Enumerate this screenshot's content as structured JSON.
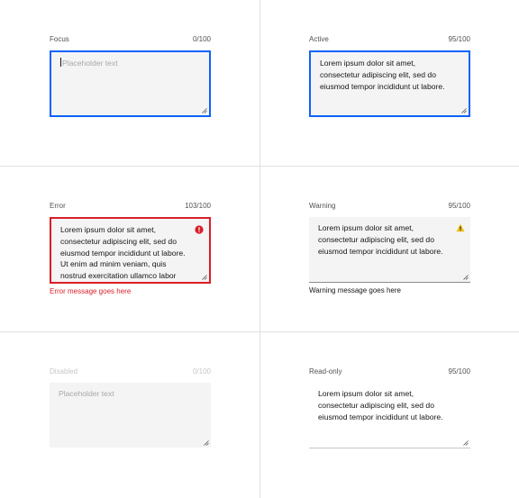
{
  "colors": {
    "focus": "#0f62fe",
    "error": "#da1e28",
    "warning": "#f1c21b",
    "field_bg": "#f4f4f4",
    "divider": "#e0e0e0"
  },
  "states": {
    "focus": {
      "label": "Focus",
      "count": "0/100",
      "placeholder": "Placeholder text"
    },
    "active": {
      "label": "Active",
      "count": "95/100",
      "value": "Lorem ipsum dolor sit amet,\nconsectetur adipiscing elit, sed do\neiusmod tempor incididunt ut labore."
    },
    "error": {
      "label": "Error",
      "count": "103/100",
      "value": "Lorem ipsum dolor sit amet,\nconsectetur adipiscing elit, sed do\neiusmod tempor incididunt ut labore.\nUt enim ad minim veniam, quis\nnostrud exercitation ullamco labor",
      "message": "Error message goes here",
      "icon": "error-filled-icon"
    },
    "warning": {
      "label": "Warning",
      "count": "95/100",
      "value": "Lorem ipsum dolor sit amet,\nconsectetur adipiscing elit, sed do\neiusmod tempor incididunt ut labore.",
      "message": "Warning message goes here",
      "icon": "warning-filled-icon"
    },
    "disabled": {
      "label": "Disabled",
      "count": "0/100",
      "placeholder": "Placeholder text"
    },
    "readonly": {
      "label": "Read-only",
      "count": "95/100",
      "value": "Lorem ipsum dolor sit amet,\nconsectetur adipiscing elit, sed do\neiusmod tempor incididunt ut labore."
    }
  }
}
